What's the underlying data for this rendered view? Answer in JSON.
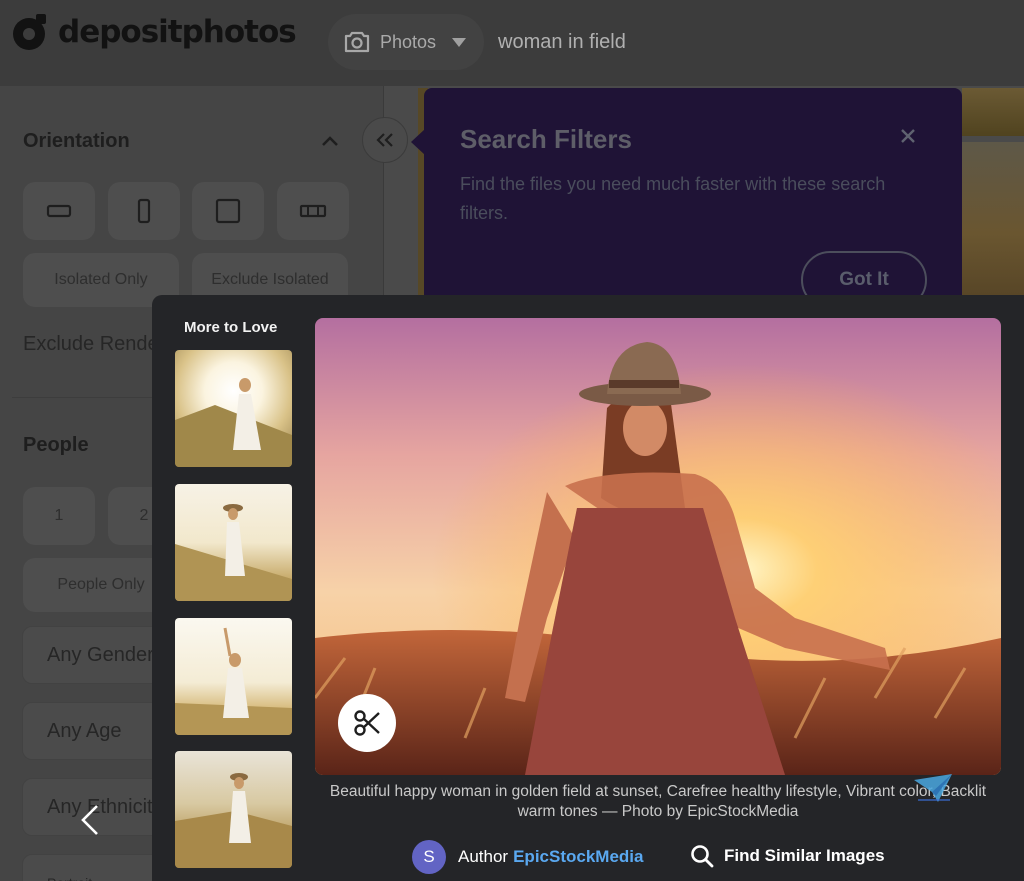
{
  "header": {
    "logo_text": "depositphotos",
    "content_type": "Photos",
    "search_query": "woman in field"
  },
  "sidebar": {
    "orientation": {
      "title": "Orientation",
      "options": [
        "horizontal",
        "vertical",
        "square",
        "panorama"
      ],
      "isolated_only": "Isolated Only",
      "exclude_isolated": "Exclude Isolated",
      "exclude_renders": "Exclude Rende"
    },
    "people": {
      "title": "People",
      "count_1": "1",
      "count_2": "2",
      "people_only": "People Only",
      "gender": "Any Gender",
      "age": "Any Age",
      "ethnicity": "Any Ethnicit",
      "last": "Portrait"
    }
  },
  "tooltip": {
    "title": "Search Filters",
    "text": "Find the files you need much faster with these search filters.",
    "button": "Got It"
  },
  "modal": {
    "more_to_love": "More to Love",
    "caption": "Beautiful happy woman in golden field at sunset, Carefree healthy lifestyle, Vibrant color, Backlit warm tones — Photo by EpicStockMedia",
    "author_initial": "S",
    "author_label": "Author",
    "author_name": "EpicStockMedia",
    "find_similar": "Find Similar Images"
  },
  "colors": {
    "dim_overlay": "#4a4a4a",
    "tooltip_bg": "#1f1336",
    "modal_bg": "#242528",
    "author_link": "#5aa8f0",
    "avatar": "#6264c4"
  }
}
